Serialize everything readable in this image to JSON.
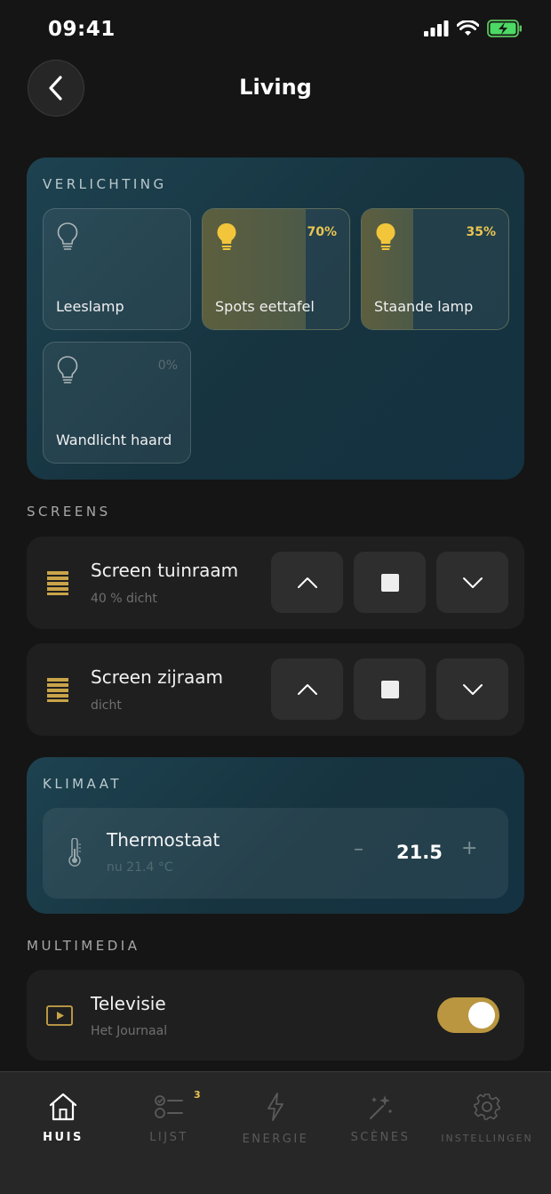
{
  "status_bar": {
    "time": "09:41"
  },
  "header": {
    "title": "Living"
  },
  "lighting": {
    "label": "VERLICHTING",
    "tiles": [
      {
        "name": "Leeslamp",
        "percent": "",
        "level": 0,
        "on": false
      },
      {
        "name": "Spots eettafel",
        "percent": "70%",
        "level": 0.7,
        "on": true
      },
      {
        "name": "Staande lamp",
        "percent": "35%",
        "level": 0.35,
        "on": true
      },
      {
        "name": "Wandlicht haard",
        "percent": "0%",
        "level": 0,
        "on": false
      }
    ]
  },
  "screens": {
    "label": "SCREENS",
    "items": [
      {
        "name": "Screen tuinraam",
        "status": "40 % dicht"
      },
      {
        "name": "Screen zijraam",
        "status": "dicht"
      }
    ]
  },
  "climate": {
    "label": "KLIMAAT",
    "thermostat": {
      "name": "Thermostaat",
      "current": "nu 21.4 °C",
      "setpoint": "21.5",
      "minus": "–",
      "plus": "+"
    }
  },
  "multimedia": {
    "label": "MULTIMEDIA",
    "tv": {
      "name": "Televisie",
      "status": "Het Journaal",
      "on": true
    }
  },
  "tabs": [
    {
      "label": "HUIS",
      "icon": "home-icon",
      "active": true
    },
    {
      "label": "LIJST",
      "icon": "checklist-icon",
      "badge": "3"
    },
    {
      "label": "ENERGIE",
      "icon": "lightning-icon"
    },
    {
      "label": "SCÈNES",
      "icon": "magic-wand-icon"
    },
    {
      "label": "INSTELLINGEN",
      "icon": "gear-icon"
    }
  ],
  "colors": {
    "accent": "#e9c552",
    "toggle": "#b9963f",
    "card_teal": "#1a3a47",
    "background": "#151515"
  }
}
